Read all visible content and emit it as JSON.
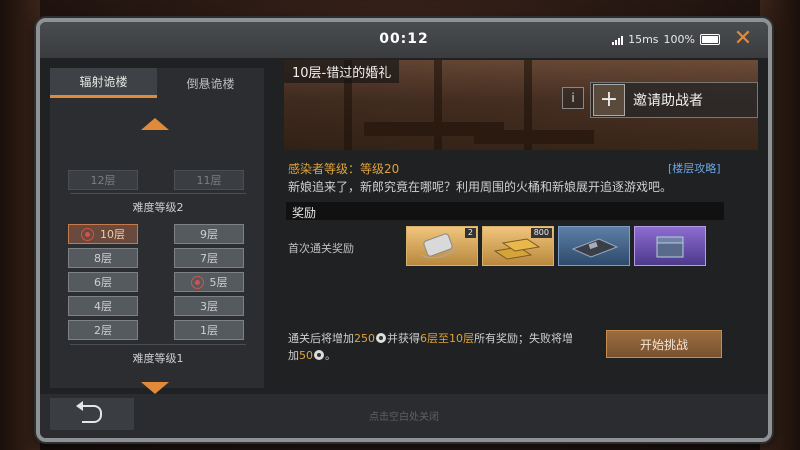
{
  "status": {
    "time": "00:12",
    "ping": "15ms",
    "battery": "100%"
  },
  "left": {
    "tabs": [
      "辐射诡楼",
      "倒悬诡楼"
    ],
    "floors_top": [
      "12层",
      "11层"
    ],
    "difficulty2": "难度等级2",
    "floors": [
      "10层",
      "9层",
      "8层",
      "7层",
      "6层",
      "5层",
      "4层",
      "3层",
      "2层",
      "1层"
    ],
    "difficulty1": "难度等级1"
  },
  "stage": {
    "title": "10层-错过的婚礼",
    "info_icon": "i",
    "invite_label": "邀请助战者",
    "infected_level": "感染者等级：等级20",
    "strategy_link": "[楼层攻略]",
    "description": "新娘追来了，新郎究竟在哪呢？利用周围的火桶和新娘展开追逐游戏吧。"
  },
  "rewards": {
    "header": "奖励",
    "first_clear_label": "首次通关奖励",
    "items": [
      {
        "icon": "dog-tag-icon",
        "qty": "2"
      },
      {
        "icon": "gold-bars-icon",
        "qty": "800"
      },
      {
        "icon": "circuit-board-icon",
        "qty": ""
      },
      {
        "icon": "treasure-chest-icon",
        "qty": ""
      }
    ]
  },
  "bottom": {
    "t1": "通关后将增加",
    "v1": "250",
    "t2": "并获得",
    "v2": "6层至10层",
    "t3": "所有奖励；失败将增加",
    "v3": "50",
    "t4": "。"
  },
  "start_button": "开始挑战",
  "tap_hint": "点击空白处关闭",
  "colors": {
    "accent": "#e08a3c",
    "gold_text": "#e0a23c",
    "link": "#6aa4e6"
  }
}
